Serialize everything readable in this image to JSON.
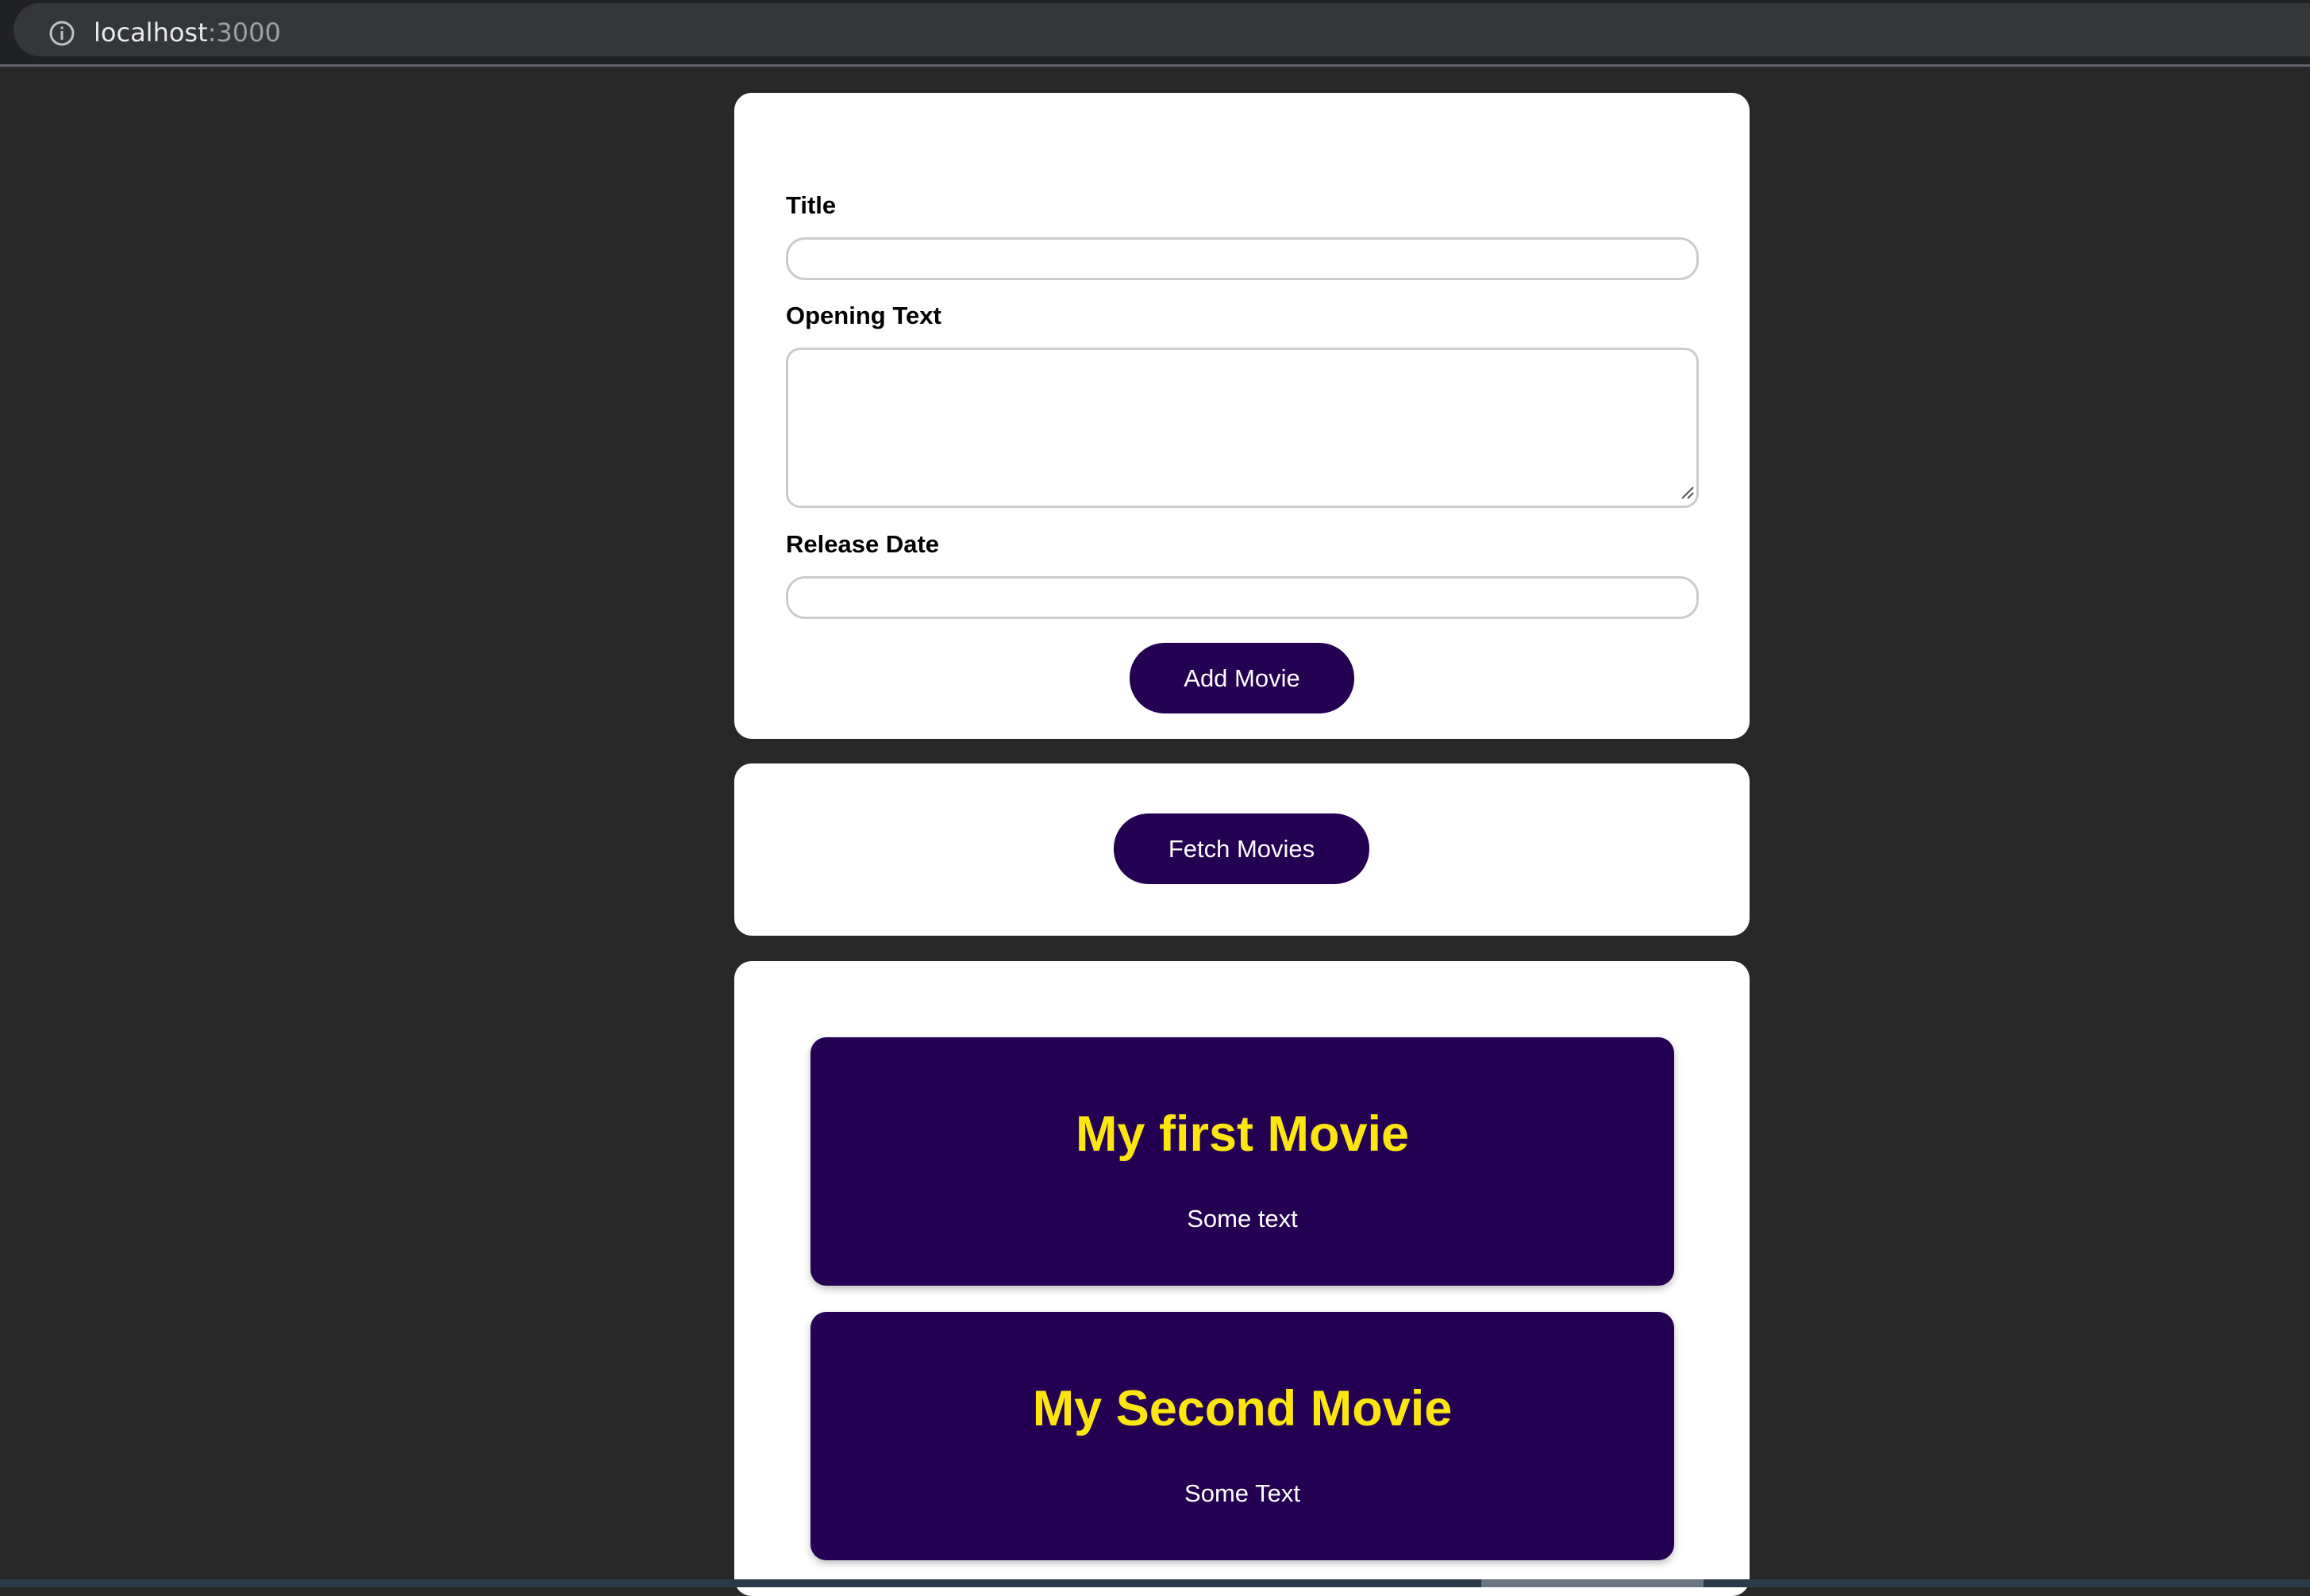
{
  "browser": {
    "host": "localhost",
    "port": ":3000",
    "info_icon": "info-icon"
  },
  "form": {
    "title_label": "Title",
    "title_value": "",
    "opening_text_label": "Opening Text",
    "opening_text_value": "",
    "release_date_label": "Release Date",
    "release_date_value": "",
    "submit_label": "Add Movie"
  },
  "actions": {
    "fetch_label": "Fetch Movies"
  },
  "movies": [
    {
      "title": "My first Movie",
      "opening_text": "Some text"
    },
    {
      "title": "My Second Movie",
      "opening_text": "Some Text"
    }
  ],
  "colors": {
    "page_background": "#282828",
    "card_background": "#ffffff",
    "accent": "#230052",
    "movie_title": "#fde60f",
    "button_text": "#ffffff"
  }
}
